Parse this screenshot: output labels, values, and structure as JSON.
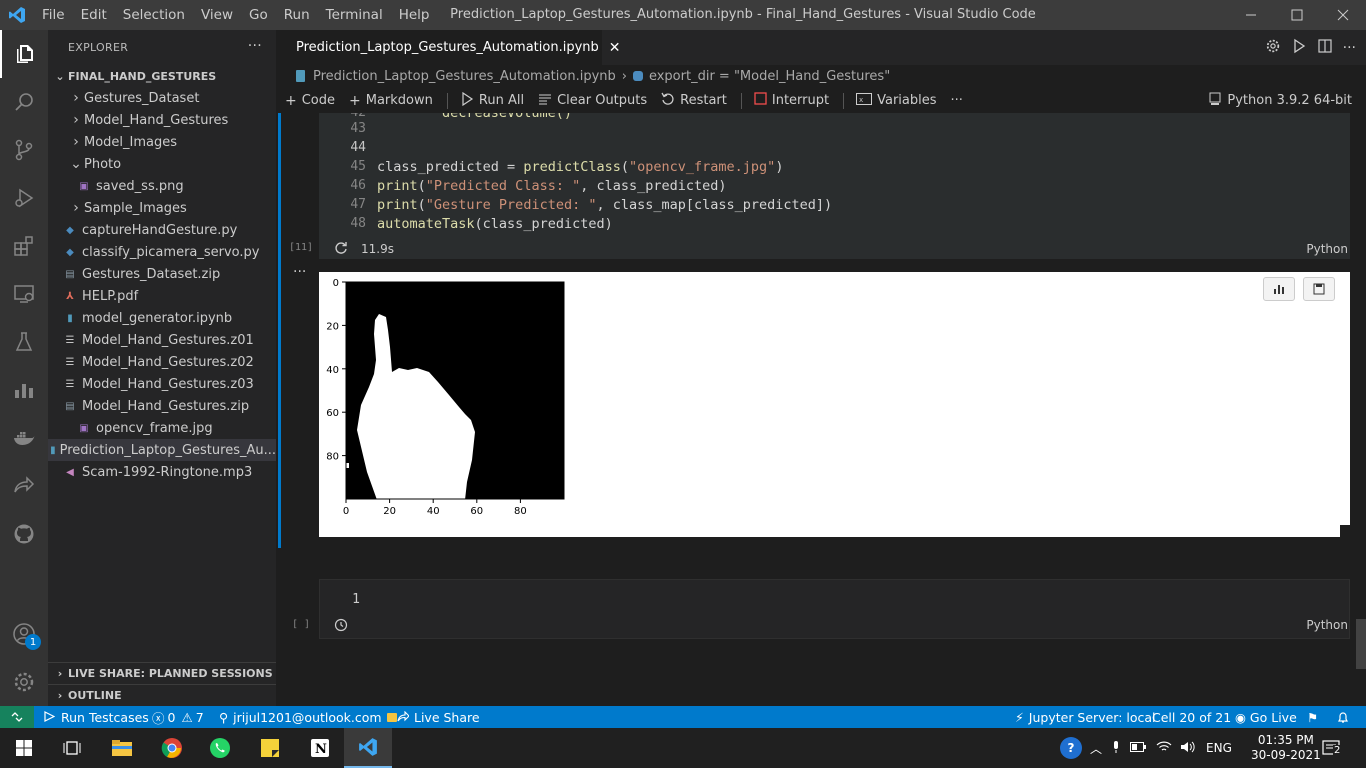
{
  "window": {
    "menu": [
      "File",
      "Edit",
      "Selection",
      "View",
      "Go",
      "Run",
      "Terminal",
      "Help"
    ],
    "title": "Prediction_Laptop_Gestures_Automation.ipynb - Final_Hand_Gestures - Visual Studio Code"
  },
  "activity": {
    "accounts_badge": "1"
  },
  "explorer": {
    "header": "EXPLORER",
    "root": "FINAL_HAND_GESTURES",
    "items": [
      {
        "label": "Gestures_Dataset",
        "kind": "folder"
      },
      {
        "label": "Model_Hand_Gestures",
        "kind": "folder"
      },
      {
        "label": "Model_Images",
        "kind": "folder"
      },
      {
        "label": "Photo",
        "kind": "folder-open"
      },
      {
        "label": "saved_ss.png",
        "kind": "image"
      },
      {
        "label": "Sample_Images",
        "kind": "folder"
      },
      {
        "label": "captureHandGesture.py",
        "kind": "python"
      },
      {
        "label": "classify_picamera_servo.py",
        "kind": "python"
      },
      {
        "label": "Gestures_Dataset.zip",
        "kind": "zip"
      },
      {
        "label": "HELP.pdf",
        "kind": "pdf"
      },
      {
        "label": "model_generator.ipynb",
        "kind": "notebook"
      },
      {
        "label": "Model_Hand_Gestures.z01",
        "kind": "text"
      },
      {
        "label": "Model_Hand_Gestures.z02",
        "kind": "text"
      },
      {
        "label": "Model_Hand_Gestures.z03",
        "kind": "text"
      },
      {
        "label": "Model_Hand_Gestures.zip",
        "kind": "zip"
      },
      {
        "label": "opencv_frame.jpg",
        "kind": "image"
      },
      {
        "label": "Prediction_Laptop_Gestures_Au...",
        "kind": "notebook"
      },
      {
        "label": "Scam-1992-Ringtone.mp3",
        "kind": "audio"
      }
    ],
    "sections": [
      "LIVE SHARE: PLANNED SESSIONS",
      "OUTLINE"
    ]
  },
  "editor": {
    "tab": "Prediction_Laptop_Gestures_Automation.ipynb",
    "breadcrumb": [
      "Prediction_Laptop_Gestures_Automation.ipynb",
      "export_dir = \"Model_Hand_Gestures\""
    ],
    "toolbar": {
      "code": "Code",
      "markdown": "Markdown",
      "run_all": "Run All",
      "clear_outputs": "Clear Outputs",
      "restart": "Restart",
      "interrupt": "Interrupt",
      "variables": "Variables",
      "kernel": "Python 3.9.2 64-bit"
    }
  },
  "cell1": {
    "exec_label": "[11]",
    "duration": "11.9s",
    "language": "Python",
    "lines": [
      {
        "n": "42",
        "code": "        decreaseVolume()"
      },
      {
        "n": "43",
        "code": ""
      },
      {
        "n": "44",
        "code": ""
      },
      {
        "n": "45",
        "parts": [
          [
            "class_predicted = ",
            ""
          ],
          [
            "predictClass",
            "fn"
          ],
          [
            "(",
            ""
          ],
          [
            "\"opencv_frame.jpg\"",
            "str"
          ],
          [
            ")",
            ""
          ]
        ]
      },
      {
        "n": "46",
        "parts": [
          [
            "print",
            "fn"
          ],
          [
            "(",
            ""
          ],
          [
            "\"Predicted Class: \"",
            "str"
          ],
          [
            ", class_predicted)",
            ""
          ]
        ]
      },
      {
        "n": "47",
        "parts": [
          [
            "print",
            "fn"
          ],
          [
            "(",
            ""
          ],
          [
            "\"Gesture Predicted: \"",
            "str"
          ],
          [
            ", class_map[class_predicted])",
            ""
          ]
        ]
      },
      {
        "n": "48",
        "parts": [
          [
            "automateTask",
            "fn"
          ],
          [
            "(class_predicted)",
            ""
          ]
        ]
      }
    ]
  },
  "plot": {
    "chart_data": {
      "type": "image",
      "title": "",
      "xlabel": "",
      "ylabel": "",
      "xticks": [
        "0",
        "20",
        "40",
        "60",
        "80"
      ],
      "yticks": [
        "0",
        "20",
        "40",
        "60",
        "80"
      ],
      "xlim": [
        0,
        100
      ],
      "ylim": [
        100,
        0
      ]
    }
  },
  "cell2": {
    "exec_label": "[ ]",
    "line_number": "1",
    "language": "Python"
  },
  "status": {
    "run_testcases": "Run Testcases",
    "errors": "0",
    "warnings": "7",
    "account": "jrijul1201@outlook.com",
    "live_share": "Live Share",
    "jupyter": "Jupyter Server: local",
    "cell": "Cell 20 of 21",
    "go_live": "Go Live"
  },
  "taskbar": {
    "lang": "ENG",
    "time": "01:35 PM",
    "date": "30-09-2021",
    "notif_count": "2"
  },
  "colors": {
    "accent": "#007acc",
    "title_bar": "#3c3c3c",
    "sidebar": "#252526",
    "editor": "#1e1e1e"
  }
}
